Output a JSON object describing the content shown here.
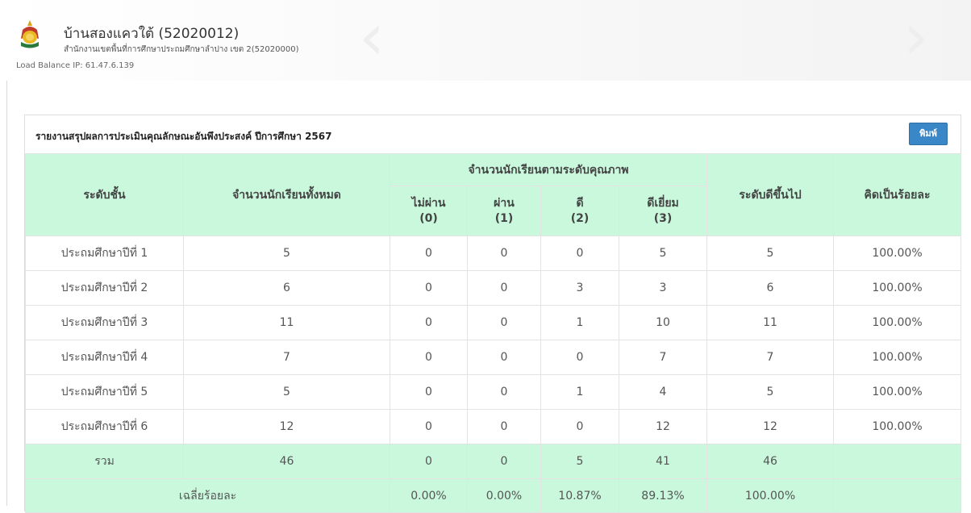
{
  "header": {
    "school_name": "บ้านสองแควใต้ (52020012)",
    "office": "สำนักงานเขตพื้นที่การศึกษาประถมศึกษาลำปาง เขต 2(52020000)",
    "load_balance": "Load Balance IP: 61.47.6.139",
    "logo_icon": "school-emblem-icon"
  },
  "report": {
    "title": "รายงานสรุปผลการประเมินคุณลักษณะอันพึงประสงค์ ปีการศึกษา 2567",
    "print_label": "พิมพ์",
    "headers": {
      "level": "ระดับชั้น",
      "total": "จำนวนนักเรียนทั้งหมด",
      "group": "จำนวนนักเรียนตามระดับคุณภาพ",
      "fail": [
        "ไม่ผ่าน",
        "(0)"
      ],
      "pass": [
        "ผ่าน",
        "(1)"
      ],
      "good": [
        "ดี",
        "(2)"
      ],
      "excellent": [
        "ดีเยี่ยม",
        "(3)"
      ],
      "good_up": "ระดับดีขึ้นไป",
      "percent": "คิดเป็นร้อยละ"
    },
    "rows": [
      {
        "level": "ประถมศึกษาปีที่ 1",
        "total": "5",
        "fail": "0",
        "pass": "0",
        "good": "0",
        "excellent": "5",
        "good_up": "5",
        "percent": "100.00%"
      },
      {
        "level": "ประถมศึกษาปีที่ 2",
        "total": "6",
        "fail": "0",
        "pass": "0",
        "good": "3",
        "excellent": "3",
        "good_up": "6",
        "percent": "100.00%"
      },
      {
        "level": "ประถมศึกษาปีที่ 3",
        "total": "11",
        "fail": "0",
        "pass": "0",
        "good": "1",
        "excellent": "10",
        "good_up": "11",
        "percent": "100.00%"
      },
      {
        "level": "ประถมศึกษาปีที่ 4",
        "total": "7",
        "fail": "0",
        "pass": "0",
        "good": "0",
        "excellent": "7",
        "good_up": "7",
        "percent": "100.00%"
      },
      {
        "level": "ประถมศึกษาปีที่ 5",
        "total": "5",
        "fail": "0",
        "pass": "0",
        "good": "1",
        "excellent": "4",
        "good_up": "5",
        "percent": "100.00%"
      },
      {
        "level": "ประถมศึกษาปีที่ 6",
        "total": "12",
        "fail": "0",
        "pass": "0",
        "good": "0",
        "excellent": "12",
        "good_up": "12",
        "percent": "100.00%"
      }
    ],
    "total_row": {
      "label": "รวม",
      "total": "46",
      "fail": "0",
      "pass": "0",
      "good": "5",
      "excellent": "41",
      "good_up": "46",
      "percent": ""
    },
    "avg_row": {
      "label": "เฉลี่ยร้อยละ",
      "fail": "0.00%",
      "pass": "0.00%",
      "good": "10.87%",
      "excellent": "89.13%",
      "good_up": "100.00%",
      "percent": ""
    }
  },
  "colors": {
    "header_green": "#c9f8dd",
    "print_button": "#3a87c8"
  }
}
